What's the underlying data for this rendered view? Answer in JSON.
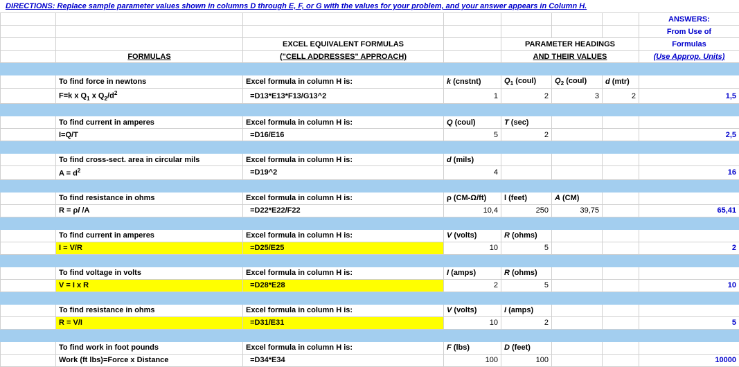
{
  "directions_label": "DIRECTIONS:",
  "directions_text": "  Replace sample parameter values shown in columns D through E, F, or G with the values for your problem, and your answer appears in Column H.",
  "headers": {
    "formulas": "FORMULAS",
    "excel1": "EXCEL EQUIVALENT FORMULAS",
    "excel2": "(\"CELL ADDRESSES\" APPROACH)",
    "params1": "PARAMETER HEADINGS",
    "params2": "AND THEIR VALUES",
    "answers1": "ANSWERS:",
    "answers2": "From Use of",
    "answers3": "Formulas",
    "answers4": "(Use Approp. Units)"
  },
  "rows": [
    {
      "desc": "To find force in newtons",
      "excel_label": "Excel formula in column H is:",
      "formula_html": "F=k x Q<sub>1</sub> x Q<sub>2</sub>/d<sup>2</sup>",
      "excel_formula": "=D13*E13*F13/G13^2",
      "param_labels": {
        "d": "k (cnstnt)",
        "e": "Q₁ (coul)",
        "f": "Q₂ (coul)",
        "g": "d (mtr)"
      },
      "param_labels_html": {
        "d": "<i>k</i> (cnstnt)",
        "e": "<i>Q</i><sub>1</sub> (coul)",
        "f": "<i>Q</i><sub>2</sub> (coul)",
        "g": "<i>d</i> (mtr)"
      },
      "values": {
        "d": "1",
        "e": "2",
        "f": "3",
        "g": "2"
      },
      "answer": "1,5",
      "highlight": false
    },
    {
      "desc": "To find current in amperes",
      "excel_label": "Excel formula in column H is:",
      "formula_html": "I=Q/T",
      "excel_formula": "=D16/E16",
      "param_labels_html": {
        "d": "<i>Q</i> (coul)",
        "e": "<i>T</i> (sec)"
      },
      "values": {
        "d": "5",
        "e": "2"
      },
      "answer": "2,5",
      "highlight": false
    },
    {
      "desc": "To find cross-sect. area in circular mils",
      "excel_label": "Excel formula in column H is:",
      "formula_html": "A = d<sup>2</sup>",
      "excel_formula": "=D19^2",
      "param_labels_html": {
        "d": "<i>d</i> (mils)"
      },
      "values": {
        "d": "4"
      },
      "answer": "16",
      "highlight": false
    },
    {
      "desc": "To find resistance in ohms",
      "excel_label": "Excel formula in column H is:",
      "formula_html": "R = ρ<i>l</i> /A",
      "excel_formula": "=D22*E22/F22",
      "param_labels_html": {
        "d": "ρ (CM-Ω/ft)",
        "e": "l (feet)",
        "f": "<i>A</i> (CM)"
      },
      "values": {
        "d": "10,4",
        "e": "250",
        "f": "39,75"
      },
      "answer": "65,41",
      "highlight": false
    },
    {
      "desc": "To find current in amperes",
      "excel_label": "Excel formula in column H is:",
      "formula_html": "I = V/R",
      "excel_formula": "=D25/E25",
      "param_labels_html": {
        "d": "<i>V</i> (volts)",
        "e": "<i>R</i> (ohms)"
      },
      "values": {
        "d": "10",
        "e": "5"
      },
      "answer": "2",
      "highlight": true
    },
    {
      "desc": "To find voltage in volts",
      "excel_label": "Excel formula in column H is:",
      "formula_html": "V = I  x R",
      "excel_formula": "=D28*E28",
      "param_labels_html": {
        "d": "<i>I</i> (amps)",
        "e": "<i>R</i> (ohms)"
      },
      "values": {
        "d": "2",
        "e": "5"
      },
      "answer": "10",
      "highlight": true
    },
    {
      "desc": "To find resistance in ohms",
      "excel_label": "Excel formula in column H is:",
      "formula_html": "R = V/I",
      "excel_formula": "=D31/E31",
      "param_labels_html": {
        "d": "<i>V</i> (volts)",
        "e": "<i>I</i> (amps)"
      },
      "values": {
        "d": "10",
        "e": "2"
      },
      "answer": "5",
      "highlight": true
    },
    {
      "desc": "To find work in foot pounds",
      "excel_label": "Excel formula in column H is:",
      "formula_html": "Work (ft lbs)=Force x Distance",
      "excel_formula": "=D34*E34",
      "param_labels_html": {
        "d": "<i>F</i> (lbs)",
        "e": "<i>D</i> (feet)"
      },
      "values": {
        "d": "100",
        "e": "100"
      },
      "answer": "10000",
      "highlight": false,
      "no_trailing_band": true
    }
  ]
}
